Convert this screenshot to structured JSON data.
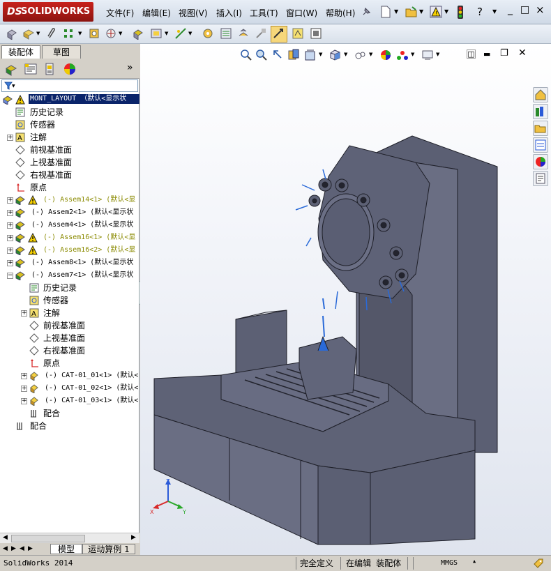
{
  "app": {
    "logo_prefix": "DS",
    "logo_text": "SOLIDWORKS",
    "menu": [
      "文件(F)",
      "编辑(E)",
      "视图(V)",
      "插入(I)",
      "工具(T)",
      "窗口(W)",
      "帮助(H)"
    ],
    "window_controls": [
      "_",
      "□",
      "×"
    ]
  },
  "left_panel": {
    "tabs": [
      "装配体",
      "草图"
    ],
    "expand_label": "»",
    "filter_icon": "funnel-icon",
    "tree": {
      "root": "MONT_LAYOUT （默认<显示状",
      "items": [
        {
          "label": "历史记录",
          "icon": "history-icon"
        },
        {
          "label": "传感器",
          "icon": "sensor-icon"
        },
        {
          "label": "注解",
          "icon": "annotation-icon"
        },
        {
          "label": "前视基准面",
          "icon": "plane-icon"
        },
        {
          "label": "上视基准面",
          "icon": "plane-icon"
        },
        {
          "label": "右视基准面",
          "icon": "plane-icon"
        },
        {
          "label": "原点",
          "icon": "origin-icon"
        },
        {
          "label": "(-) Assem14<1> (默认<显",
          "icon": "assembly-icon",
          "warning": true
        },
        {
          "label": "(-) Assem2<1> (默认<显示状",
          "icon": "assembly-icon"
        },
        {
          "label": "(-) Assem4<1> (默认<显示状",
          "icon": "assembly-icon"
        },
        {
          "label": "(-) Assem16<1> (默认<显",
          "icon": "assembly-icon",
          "warning": true
        },
        {
          "label": "(-) Assem16<2> (默认<显",
          "icon": "assembly-icon",
          "warning": true
        },
        {
          "label": "(-) Assem8<1> (默认<显示状",
          "icon": "assembly-icon"
        },
        {
          "label": "(-) Assem7<1> (默认<显示状",
          "icon": "assembly-icon"
        },
        {
          "label": "历史记录",
          "icon": "history-icon"
        },
        {
          "label": "传感器",
          "icon": "sensor-icon"
        },
        {
          "label": "注解",
          "icon": "annotation-icon"
        },
        {
          "label": "前视基准面",
          "icon": "plane-icon"
        },
        {
          "label": "上视基准面",
          "icon": "plane-icon"
        },
        {
          "label": "右视基准面",
          "icon": "plane-icon"
        },
        {
          "label": "原点",
          "icon": "origin-icon"
        },
        {
          "label": "(-) CAT-01_01<1> (默认<",
          "icon": "part-icon"
        },
        {
          "label": "(-) CAT-01_02<1> (默认<",
          "icon": "part-icon"
        },
        {
          "label": "(-) CAT-01_03<1> (默认<",
          "icon": "part-icon"
        },
        {
          "label": "配合",
          "icon": "mate-icon"
        },
        {
          "label": "配合",
          "icon": "mate-icon"
        }
      ]
    },
    "bottom_tabs": [
      "模型",
      "运动算例 1"
    ]
  },
  "viewport": {
    "triad_labels": [
      "Z",
      "X",
      "Y"
    ]
  },
  "status_bar": {
    "app_version": "SolidWorks 2014",
    "definition_state": "完全定义",
    "edit_state": "在编辑 装配体",
    "units": "MMGS"
  },
  "colors": {
    "model_body": "#5b5f73",
    "model_edge": "#1e1f28",
    "selection": "#0a246a",
    "warning": "#e8c000"
  }
}
